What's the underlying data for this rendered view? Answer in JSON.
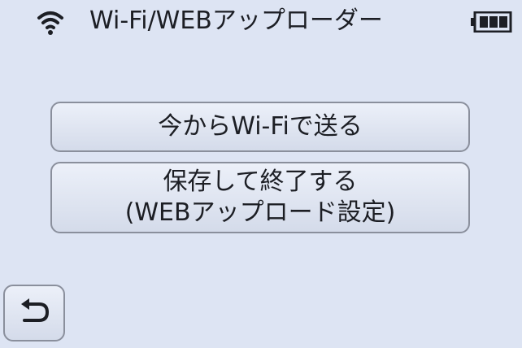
{
  "header": {
    "wifi_icon": "wifi-signal-icon",
    "title": "Wi-Fi/WEBアップローダー",
    "battery_icon": "battery-icon"
  },
  "menu": {
    "send_now_label": "今からWi-Fiで送る",
    "save_exit_line1": "保存して終了する",
    "save_exit_line2": "(WEBアップロード設定)"
  },
  "footer": {
    "back_icon": "return-arrow-icon"
  },
  "colors": {
    "background": "#dde4f3",
    "button_border": "#8a8f9c",
    "text": "#1c1e24"
  }
}
